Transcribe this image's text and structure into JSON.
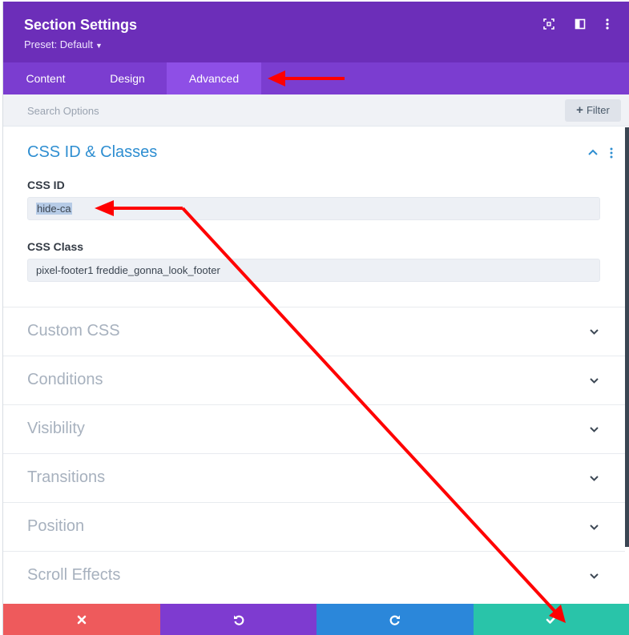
{
  "header": {
    "title": "Section Settings",
    "preset": "Preset: Default",
    "icons": [
      "expand-icon",
      "split-view-icon",
      "more-vertical-icon"
    ]
  },
  "tabs": [
    {
      "label": "Content",
      "active": false
    },
    {
      "label": "Design",
      "active": false
    },
    {
      "label": "Advanced",
      "active": true
    }
  ],
  "search": {
    "placeholder": "Search Options",
    "filter_label": "Filter"
  },
  "open_section": {
    "title": "CSS ID & Classes",
    "fields": [
      {
        "label": "CSS ID",
        "value": "hide-ca"
      },
      {
        "label": "CSS Class",
        "value": "pixel-footer1 freddie_gonna_look_footer"
      }
    ]
  },
  "collapsed_sections": [
    "Custom CSS",
    "Conditions",
    "Visibility",
    "Transitions",
    "Position",
    "Scroll Effects"
  ],
  "footer": {
    "buttons": [
      {
        "name": "cancel",
        "icon": "close-icon",
        "color": "#ee5a5c"
      },
      {
        "name": "undo",
        "icon": "undo-icon",
        "color": "#7e3bd0"
      },
      {
        "name": "redo",
        "icon": "redo-icon",
        "color": "#2b87da"
      },
      {
        "name": "save",
        "icon": "checkmark-icon",
        "color": "#29c4a9"
      }
    ]
  },
  "colors": {
    "header": "#6c2eb9",
    "tabs": "#7b3dd0",
    "active_tab": "#8e4fe6",
    "accent_blue": "#2e8ed1",
    "annotation_red": "#ff0000"
  }
}
